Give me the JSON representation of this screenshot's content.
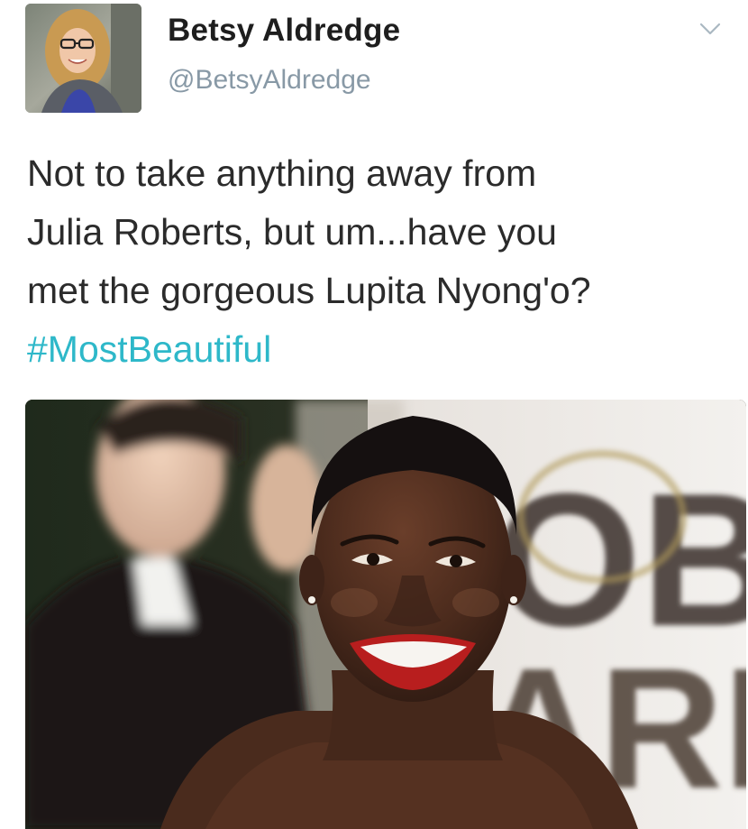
{
  "user": {
    "display_name": "Betsy Aldredge",
    "handle": "@BetsyAldredge",
    "avatar_icon": "profile-photo"
  },
  "menu": {
    "icon": "chevron-down-icon"
  },
  "tweet": {
    "lines": [
      "Not to take anything away from",
      "Julia Roberts, but um...have you",
      "met the gorgeous Lupita Nyong'o?"
    ],
    "hashtag": "#MostBeautiful"
  },
  "media": {
    "backdrop_letters": [
      "OB",
      "ARD"
    ]
  },
  "colors": {
    "hashtag": "#2eb8c9",
    "handle": "#8899a6",
    "name": "#1e1e1e",
    "text": "#2b2b2b"
  }
}
